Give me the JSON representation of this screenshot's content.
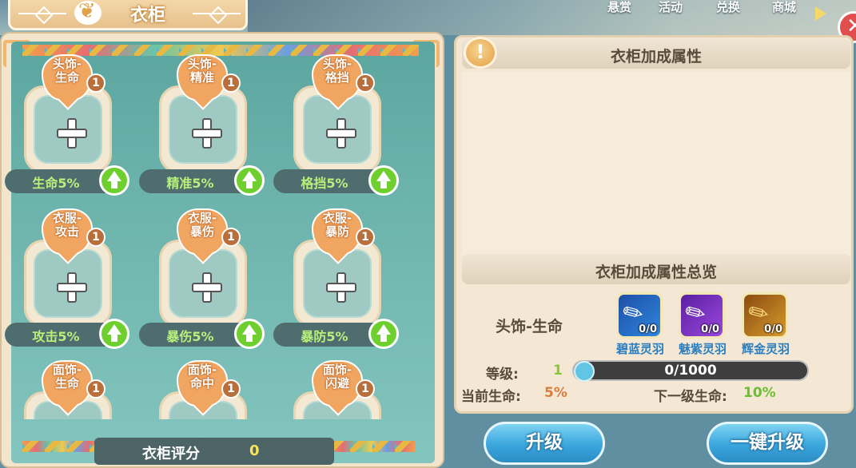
{
  "topbar": {
    "menu": [
      "悬赏",
      "活动",
      "兑换",
      "商城"
    ],
    "close_symbol": "✕"
  },
  "title": "衣柜",
  "slots": [
    {
      "name_line1": "头饰-",
      "name_line2": "生命",
      "level": "1",
      "stat": "生命5%"
    },
    {
      "name_line1": "头饰-",
      "name_line2": "精准",
      "level": "1",
      "stat": "精准5%"
    },
    {
      "name_line1": "头饰-",
      "name_line2": "格挡",
      "level": "1",
      "stat": "格挡5%"
    },
    {
      "name_line1": "衣服-",
      "name_line2": "攻击",
      "level": "1",
      "stat": "攻击5%"
    },
    {
      "name_line1": "衣服-",
      "name_line2": "暴伤",
      "level": "1",
      "stat": "暴伤5%"
    },
    {
      "name_line1": "衣服-",
      "name_line2": "暴防",
      "level": "1",
      "stat": "暴防5%"
    },
    {
      "name_line1": "面饰-",
      "name_line2": "生命",
      "level": "1"
    },
    {
      "name_line1": "面饰-",
      "name_line2": "命中",
      "level": "1"
    },
    {
      "name_line1": "面饰-",
      "name_line2": "闪避",
      "level": "1"
    }
  ],
  "score": {
    "label": "衣柜评分",
    "value": "0"
  },
  "right": {
    "warn_symbol": "!",
    "header": "衣柜加成属性",
    "overview_header": "衣柜加成属性总览",
    "selected_item": "头饰-生命",
    "feathers": [
      {
        "name": "碧蓝灵羽",
        "count": "0/0",
        "color": "#2b6fd1"
      },
      {
        "name": "魅紫灵羽",
        "count": "0/0",
        "color": "#8b3fd6"
      },
      {
        "name": "辉金灵羽",
        "count": "0/0",
        "color": "#d69a2b"
      }
    ],
    "level_label": "等级:",
    "level_value": "1",
    "progress_text": "0/1000",
    "progress": 0,
    "current_label": "当前生命:",
    "current_value": "5%",
    "next_label": "下一级生命:",
    "next_value": "10%"
  },
  "buttons": {
    "upgrade": "升级",
    "upgrade_all": "一键升级"
  }
}
